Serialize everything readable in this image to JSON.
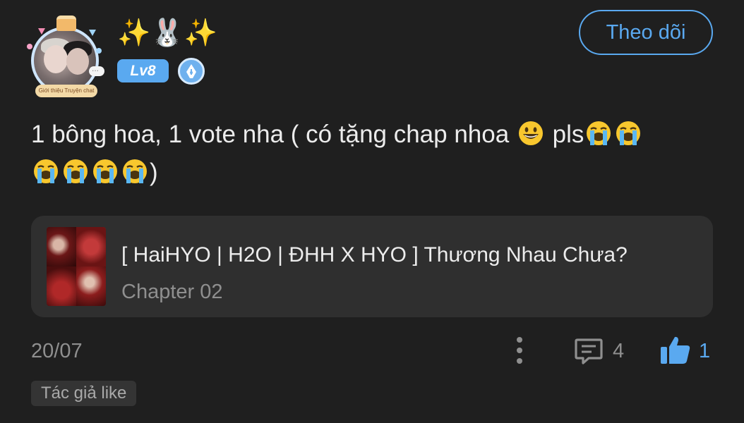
{
  "user": {
    "nickname": "✨🐰✨",
    "level": "Lv8",
    "avatar_banner": "Giới thiệu Truyện chat"
  },
  "header": {
    "follow_label": "Theo dõi"
  },
  "comment": {
    "text_before": "1 bông hoa, 1 vote nha ( có tặng chap nhoa ",
    "text_middle": " pls",
    "text_end": ")",
    "emoji_grin": "grinning-face",
    "emoji_cry": "loudly-crying-face"
  },
  "chapter_card": {
    "title": "[ HaiHYO | H2O | ĐHH X HYO ] Thương Nhau Chưa?",
    "subtitle": "Chapter 02"
  },
  "footer": {
    "date": "20/07",
    "reply_count": "4",
    "like_count": "1"
  },
  "tags": {
    "author_like": "Tác giả like"
  },
  "colors": {
    "background": "#1f1f1f",
    "accent": "#5aa9f0",
    "card": "#2f2f2f",
    "muted_text": "#8f8f8f"
  }
}
